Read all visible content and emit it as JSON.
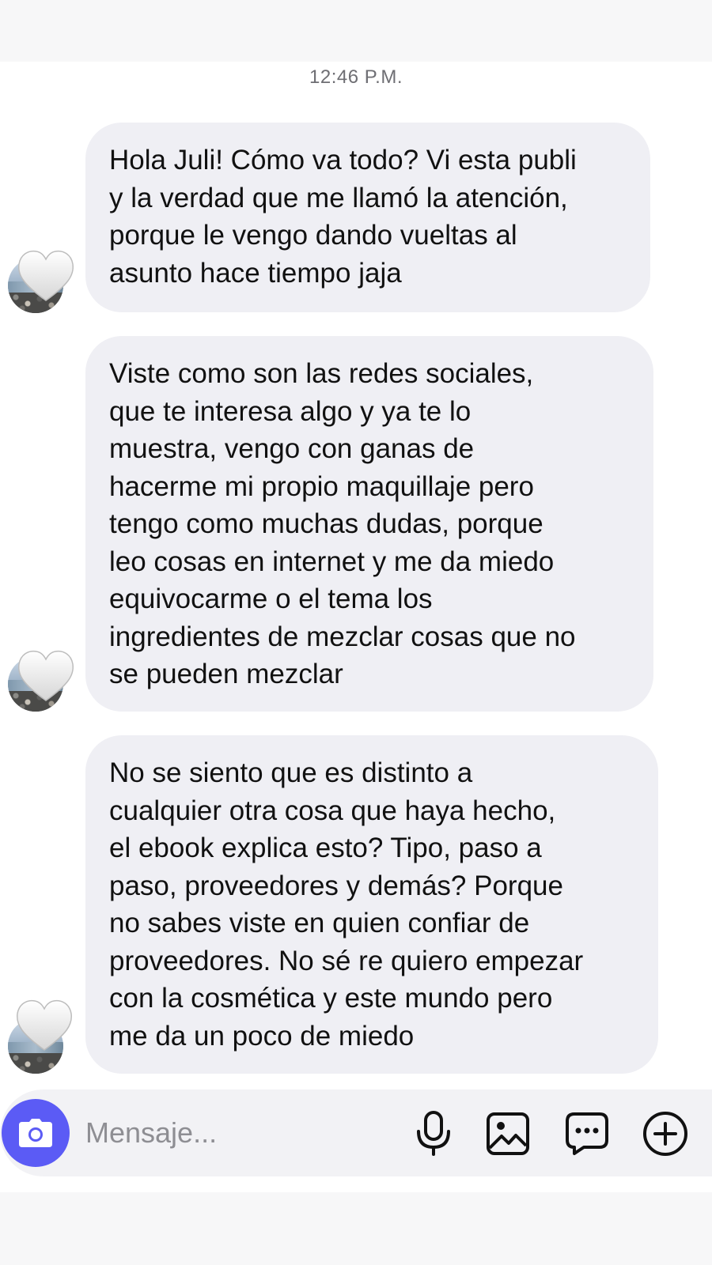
{
  "conversation": {
    "timestamp": "12:46 P.M.",
    "messages": [
      {
        "lines": [
          "Hola Juli! Cómo va todo? Vi esta publi",
          "y la verdad que me llamó la atención,",
          "porque le vengo dando vueltas al",
          "asunto hace tiempo jaja"
        ],
        "reaction": "🤍"
      },
      {
        "lines": [
          "Viste como son las redes sociales,",
          "que te interesa algo y ya te lo",
          "muestra, vengo con ganas de",
          "hacerme mi propio maquillaje pero",
          "tengo como muchas dudas, porque",
          "leo cosas en internet y me da miedo",
          "equivocarme o el tema los",
          "ingredientes de mezclar cosas que no",
          "se pueden mezclar"
        ],
        "reaction": "🤍"
      },
      {
        "lines": [
          "No se siento que es distinto a",
          "cualquier otra cosa que haya hecho,",
          "el ebook explica esto? Tipo, paso a",
          "paso, proveedores y demás? Porque",
          "no sabes viste en quien confiar de",
          "proveedores. No sé re quiero empezar",
          "con la cosmética y este mundo pero",
          "me da un poco de miedo"
        ],
        "reaction": "🤍"
      }
    ]
  },
  "composer": {
    "placeholder": "Mensaje...",
    "icons": [
      "camera-icon",
      "microphone-icon",
      "gallery-icon",
      "sticker-chat-icon",
      "plus-circle-icon"
    ]
  },
  "colors": {
    "bubble": "#efeff4",
    "accent": "#5b5bf5",
    "timestamp": "#6e6e73"
  }
}
